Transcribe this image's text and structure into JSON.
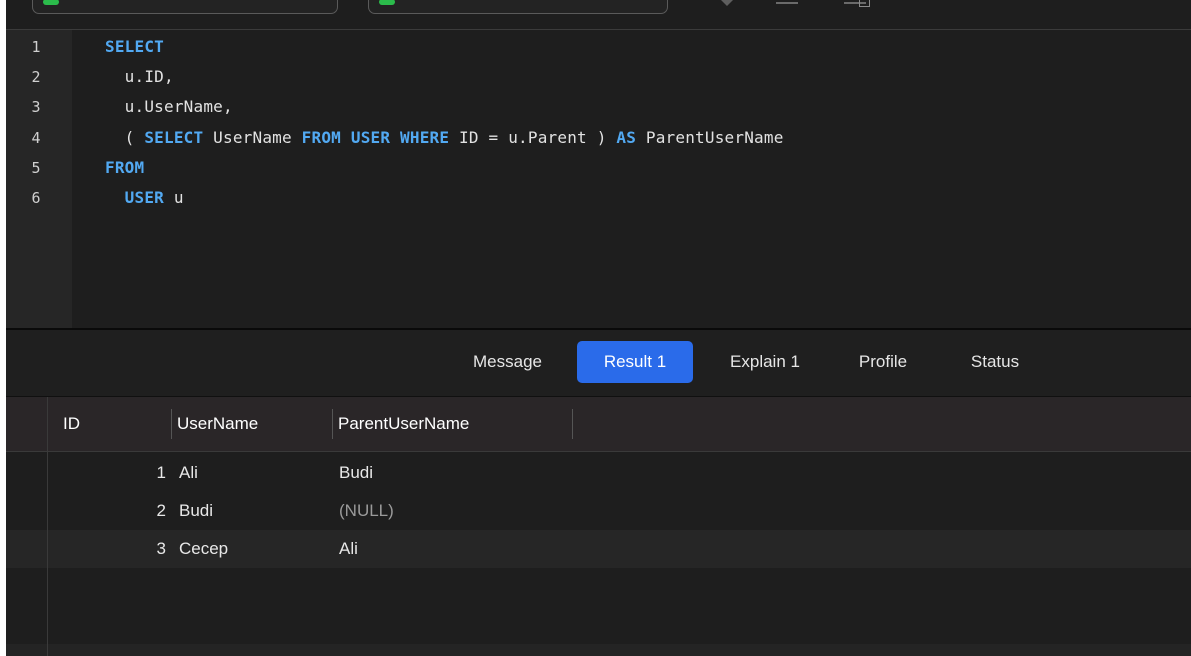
{
  "editor": {
    "line_numbers": [
      "1",
      "2",
      "3",
      "4",
      "5",
      "6"
    ],
    "lines": [
      [
        {
          "t": "SELECT",
          "kw": true
        }
      ],
      [
        {
          "t": "  u.ID,",
          "kw": false
        }
      ],
      [
        {
          "t": "  u.UserName,",
          "kw": false
        }
      ],
      [
        {
          "t": "  ( ",
          "kw": false
        },
        {
          "t": "SELECT",
          "kw": true
        },
        {
          "t": " UserName ",
          "kw": false
        },
        {
          "t": "FROM",
          "kw": true
        },
        {
          "t": " ",
          "kw": false
        },
        {
          "t": "USER",
          "kw": true
        },
        {
          "t": " ",
          "kw": false
        },
        {
          "t": "WHERE",
          "kw": true
        },
        {
          "t": " ID = u.Parent ) ",
          "kw": false
        },
        {
          "t": "AS",
          "kw": true
        },
        {
          "t": " ParentUserName",
          "kw": false
        }
      ],
      [
        {
          "t": "FROM",
          "kw": true
        }
      ],
      [
        {
          "t": "  ",
          "kw": false
        },
        {
          "t": "USER",
          "kw": true
        },
        {
          "t": " u",
          "kw": false
        }
      ]
    ]
  },
  "tabs": [
    {
      "label": "Message",
      "active": false
    },
    {
      "label": "Result 1",
      "active": true
    },
    {
      "label": "Explain 1",
      "active": false
    },
    {
      "label": "Profile",
      "active": false
    },
    {
      "label": "Status",
      "active": false
    }
  ],
  "grid": {
    "columns": [
      "ID",
      "UserName",
      "ParentUserName"
    ],
    "rows": [
      {
        "id": "1",
        "username": "Ali",
        "parent": "Budi",
        "parent_null": false
      },
      {
        "id": "2",
        "username": "Budi",
        "parent": "(NULL)",
        "parent_null": true
      },
      {
        "id": "3",
        "username": "Cecep",
        "parent": "Ali",
        "parent_null": false
      }
    ]
  },
  "colors": {
    "keyword": "#52a9f2",
    "active_tab": "#2a6bea",
    "connection_dot": "#2bbb4b"
  }
}
